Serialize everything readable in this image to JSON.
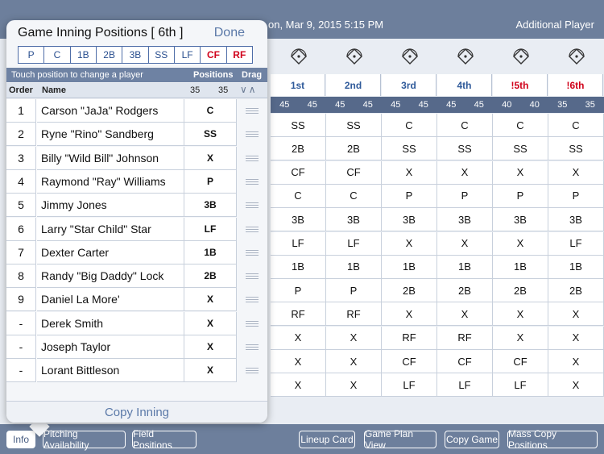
{
  "topbar": {
    "date_text": "on, Mar 9, 2015 5:15 PM",
    "additional_player": "Additional Player"
  },
  "innings": [
    {
      "label": "1st",
      "highlight": false
    },
    {
      "label": "2nd",
      "highlight": false
    },
    {
      "label": "3rd",
      "highlight": false
    },
    {
      "label": "4th",
      "highlight": false
    },
    {
      "label": "!5th",
      "highlight": true
    },
    {
      "label": "!6th",
      "highlight": true
    }
  ],
  "counts": [
    [
      "45",
      "45"
    ],
    [
      "45",
      "45"
    ],
    [
      "45",
      "45"
    ],
    [
      "45",
      "45"
    ],
    [
      "40",
      "40"
    ],
    [
      "35",
      "35"
    ]
  ],
  "count_lead": "45",
  "grid": [
    [
      "SS",
      "SS",
      "C",
      "C",
      "C",
      "C"
    ],
    [
      "2B",
      "2B",
      "SS",
      "SS",
      "SS",
      "SS"
    ],
    [
      "CF",
      "CF",
      "X",
      "X",
      "X",
      "X"
    ],
    [
      "C",
      "C",
      "P",
      "P",
      "P",
      "P"
    ],
    [
      "3B",
      "3B",
      "3B",
      "3B",
      "3B",
      "3B"
    ],
    [
      "LF",
      "LF",
      "X",
      "X",
      "X",
      "LF"
    ],
    [
      "1B",
      "1B",
      "1B",
      "1B",
      "1B",
      "1B"
    ],
    [
      "P",
      "P",
      "2B",
      "2B",
      "2B",
      "2B"
    ],
    [
      "RF",
      "RF",
      "X",
      "X",
      "X",
      "X"
    ],
    [
      "X",
      "X",
      "RF",
      "RF",
      "X",
      "X"
    ],
    [
      "X",
      "X",
      "CF",
      "CF",
      "CF",
      "X"
    ],
    [
      "X",
      "X",
      "LF",
      "LF",
      "LF",
      "X"
    ]
  ],
  "popover": {
    "title": "Game Inning Positions [ 6th ]",
    "done_label": "Done",
    "positions": [
      {
        "label": "P",
        "highlight": false
      },
      {
        "label": "C",
        "highlight": false
      },
      {
        "label": "1B",
        "highlight": false
      },
      {
        "label": "2B",
        "highlight": false
      },
      {
        "label": "3B",
        "highlight": false
      },
      {
        "label": "SS",
        "highlight": false
      },
      {
        "label": "LF",
        "highlight": false
      },
      {
        "label": "CF",
        "highlight": true
      },
      {
        "label": "RF",
        "highlight": true
      }
    ],
    "touch_hint": "Touch position to change a player",
    "positions_header": "Positions",
    "drag_header": "Drag",
    "order_header": "Order",
    "name_header": "Name",
    "pos_count_1": "35",
    "pos_count_2": "35",
    "drag_arrows": "∨∧",
    "players": [
      {
        "order": "1",
        "name": "Carson \"JaJa\" Rodgers",
        "position": "C"
      },
      {
        "order": "2",
        "name": "Ryne \"Rino\" Sandberg",
        "position": "SS"
      },
      {
        "order": "3",
        "name": "Billy \"Wild Bill\" Johnson",
        "position": "X"
      },
      {
        "order": "4",
        "name": "Raymond \"Ray\" Williams",
        "position": "P"
      },
      {
        "order": "5",
        "name": "Jimmy Jones",
        "position": "3B"
      },
      {
        "order": "6",
        "name": "Larry \"Star Child\" Star",
        "position": "LF"
      },
      {
        "order": "7",
        "name": "Dexter Carter",
        "position": "1B"
      },
      {
        "order": "8",
        "name": "Randy \"Big Daddy\" Lock",
        "position": "2B"
      },
      {
        "order": "9",
        "name": "Daniel La More'",
        "position": "X"
      },
      {
        "order": "-",
        "name": "Derek Smith",
        "position": "X"
      },
      {
        "order": "-",
        "name": "Joseph Taylor",
        "position": "X"
      },
      {
        "order": "-",
        "name": "Lorant Bittleson",
        "position": "X"
      }
    ],
    "copy_inning_label": "Copy Inning"
  },
  "bottombar": {
    "info": "Info",
    "pitching": "Pitching Availability",
    "field_positions": "Field Positions",
    "lineup_card": "Lineup Card",
    "game_plan": "Game Plan View",
    "copy_game": "Copy Game",
    "mass_copy": "Mass Copy Positions"
  },
  "colors": {
    "accent": "#5b79a8",
    "highlight_red": "#d0021b",
    "header_bg": "#6d7f9c"
  }
}
